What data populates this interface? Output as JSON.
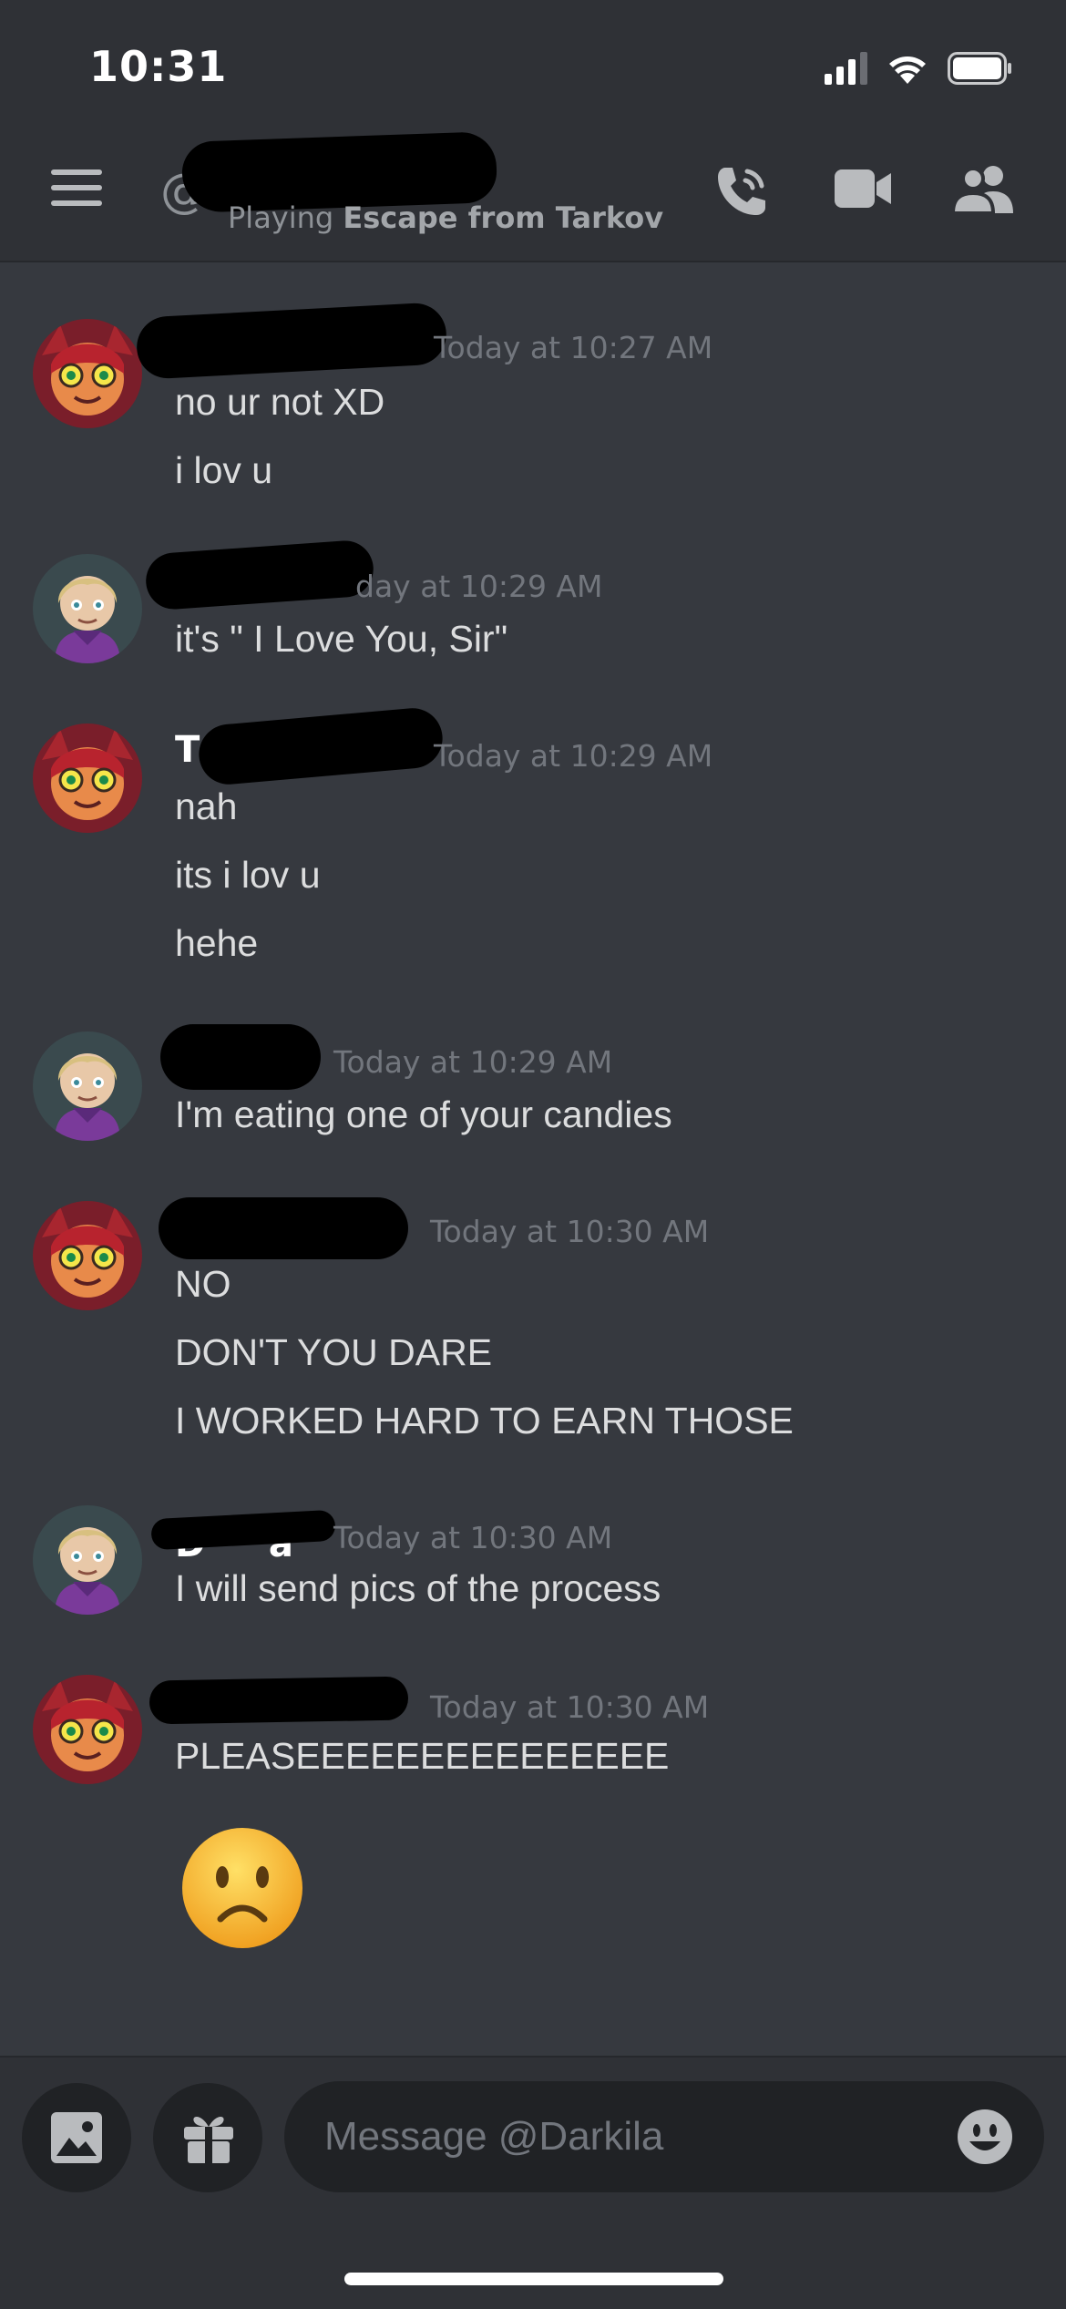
{
  "status_bar": {
    "time": "10:31",
    "signal_icon": "signal-bars-icon",
    "wifi_icon": "wifi-icon",
    "battery_icon": "battery-icon"
  },
  "header": {
    "menu_icon": "hamburger-menu-icon",
    "at_icon": "at-sign-icon",
    "activity_prefix": "Playing ",
    "activity_game": "Escape from Tarkov",
    "call_icon": "phone-call-icon",
    "video_icon": "video-camera-icon",
    "members_icon": "members-icon"
  },
  "messages": [
    {
      "author": "user-a",
      "timestamp": "Today at 10:27 AM",
      "lines": [
        "no ur not XD",
        "i lov u"
      ]
    },
    {
      "author": "user-b",
      "timestamp": "day at 10:29 AM",
      "lines": [
        "it's \" I Love You, Sir\""
      ]
    },
    {
      "author": "user-a",
      "name_visible": "T",
      "timestamp": "Today at 10:29 AM",
      "lines": [
        "nah",
        "its i lov u",
        "hehe"
      ]
    },
    {
      "author": "user-b",
      "timestamp": "Today at 10:29 AM",
      "lines": [
        "I'm eating one of your candies"
      ]
    },
    {
      "author": "user-a",
      "timestamp": "Today at 10:30 AM",
      "lines": [
        "NO",
        "DON'T YOU DARE",
        "I WORKED HARD TO EARN THOSE"
      ]
    },
    {
      "author": "user-b",
      "name_visible": "D     a",
      "timestamp": "Today at 10:30 AM",
      "lines": [
        "I will send pics of the process"
      ]
    },
    {
      "author": "user-a",
      "timestamp": "Today at 10:30 AM",
      "lines": [
        "PLEASEEEEEEEEEEEEEEE"
      ],
      "emoji": "frowning-face-emoji"
    }
  ],
  "composer": {
    "image_icon": "image-icon",
    "gift_icon": "gift-icon",
    "placeholder": "Message @Darkila",
    "emoji_icon": "smiley-emoji-icon"
  },
  "colors": {
    "background": "#36393f",
    "header": "#2f3136",
    "input": "#202225",
    "text": "#dcddde",
    "muted": "#72767d"
  }
}
